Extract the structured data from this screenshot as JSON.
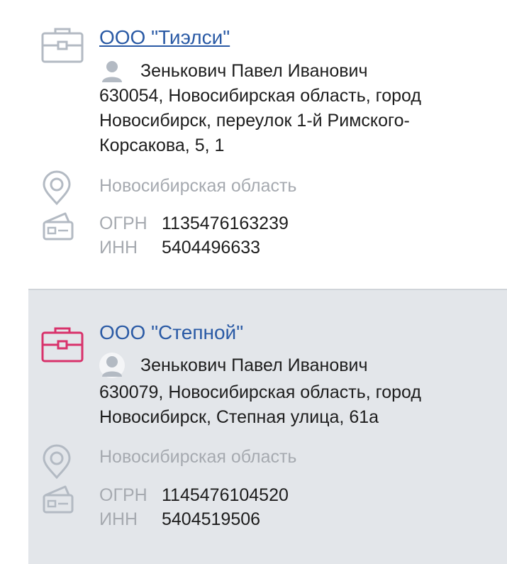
{
  "companies": [
    {
      "name": "ООО \"Тиэлси\"",
      "person": "Зенькович Павел Иванович",
      "address": "630054, Новосибирская область, город Новосибирск, переулок 1-й Римского-Корсакова, 5, 1",
      "region": "Новосибирская область",
      "ogrn_label": "ОГРН",
      "ogrn": "1135476163239",
      "inn_label": "ИНН",
      "inn": "5404496633",
      "briefcase_color": "#b3bac3",
      "briefcase_icon": "briefcase-icon"
    },
    {
      "name": "ООО \"Степной\"",
      "person": "Зенькович Павел Иванович",
      "address": "630079, Новосибирская область, город Новосибирск, Степная улица, 61а",
      "region": "Новосибирская область",
      "ogrn_label": "ОГРН",
      "ogrn": "1145476104520",
      "inn_label": "ИНН",
      "inn": "5404519506",
      "briefcase_color": "#d8326b",
      "briefcase_icon": "briefcase-icon"
    }
  ],
  "colors": {
    "link": "#2a5aa5",
    "muted": "#a6aab0",
    "text": "#1d1d1d",
    "selected_bg": "#e3e6ea",
    "icon_gray": "#b3bac3"
  }
}
